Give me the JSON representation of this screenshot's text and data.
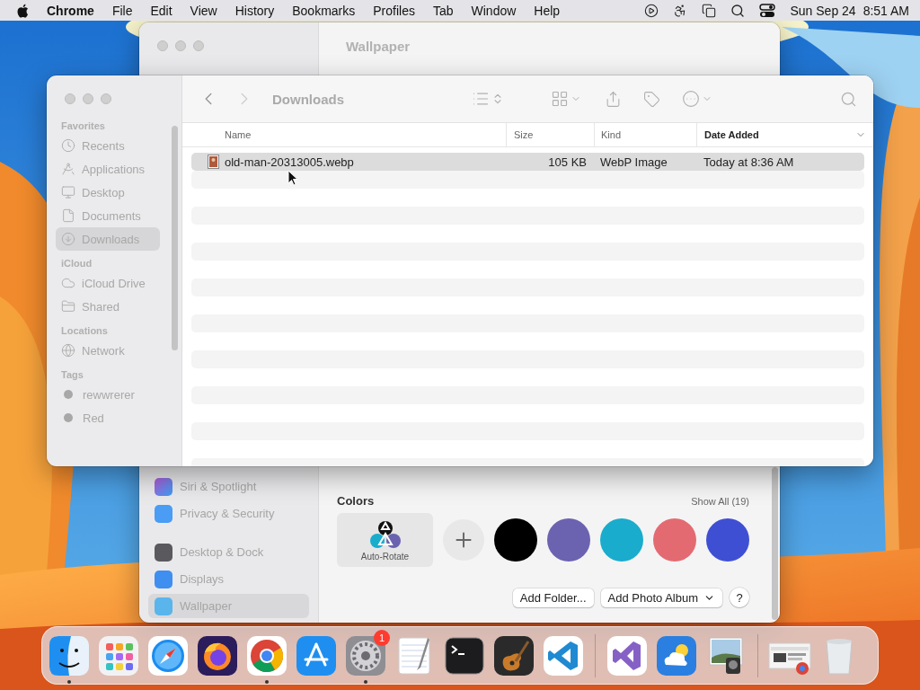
{
  "menu_bar": {
    "app_name": "Chrome",
    "menus": [
      "File",
      "Edit",
      "View",
      "History",
      "Bookmarks",
      "Profiles",
      "Tab",
      "Window",
      "Help"
    ],
    "date": "Sun Sep 24",
    "time": "8:51 AM"
  },
  "settings": {
    "title": "Wallpaper",
    "sidebar": {
      "groups": [
        [
          {
            "label": "Siri & Spotlight",
            "selected": false
          },
          {
            "label": "Privacy & Security",
            "selected": false
          }
        ],
        [
          {
            "label": "Desktop & Dock",
            "selected": false
          },
          {
            "label": "Displays",
            "selected": false
          },
          {
            "label": "Wallpaper",
            "selected": true
          }
        ]
      ]
    },
    "colors": {
      "heading": "Colors",
      "show_all": "Show All (19)",
      "swatches": [
        {
          "kind": "auto-rotate",
          "label": "Auto-Rotate"
        },
        {
          "kind": "add"
        },
        {
          "kind": "color",
          "color": "#000000"
        },
        {
          "kind": "color",
          "color": "#6b63b0"
        },
        {
          "kind": "color",
          "color": "#1aaccc"
        },
        {
          "kind": "color",
          "color": "#e46a72"
        },
        {
          "kind": "color",
          "color": "#3f4fd4"
        }
      ]
    },
    "buttons": [
      {
        "kind": "plain",
        "label": "Add Folder..."
      },
      {
        "kind": "dropdown",
        "label": "Add Photo Album"
      },
      {
        "kind": "help",
        "label": "?"
      }
    ]
  },
  "finder": {
    "title": "Downloads",
    "sidebar": [
      {
        "heading": "Favorites",
        "items": [
          {
            "label": "Recents",
            "selected": false
          },
          {
            "label": "Applications",
            "selected": false
          },
          {
            "label": "Desktop",
            "selected": false
          },
          {
            "label": "Documents",
            "selected": false
          },
          {
            "label": "Downloads",
            "selected": true
          }
        ]
      },
      {
        "heading": "iCloud",
        "items": [
          {
            "label": "iCloud Drive",
            "selected": false
          },
          {
            "label": "Shared",
            "selected": false
          }
        ]
      },
      {
        "heading": "Locations",
        "items": [
          {
            "label": "Network",
            "selected": false
          }
        ]
      },
      {
        "heading": "Tags",
        "items": [
          {
            "label": "rewwrerer",
            "selected": false,
            "color": "#a8a8a8"
          },
          {
            "label": "Red",
            "selected": false,
            "color": "#a8a8a8"
          }
        ]
      }
    ],
    "columns": [
      {
        "label": "Name",
        "sorted": false
      },
      {
        "label": "Size",
        "sorted": false
      },
      {
        "label": "Kind",
        "sorted": false
      },
      {
        "label": "Date Added",
        "sorted": true
      }
    ],
    "files": [
      {
        "name": "old-man-20313005.webp",
        "size": "105 KB",
        "kind": "WebP Image",
        "date_added": "Today at 8:36 AM",
        "selected": true
      }
    ]
  },
  "dock": {
    "groups": [
      [
        {
          "kind": "finder",
          "running": true
        },
        {
          "kind": "launchpad",
          "running": false
        },
        {
          "kind": "safari",
          "running": false
        },
        {
          "kind": "firefox",
          "running": false
        },
        {
          "kind": "chrome",
          "running": true
        },
        {
          "kind": "app-store",
          "running": false
        },
        {
          "kind": "settings",
          "running": true,
          "badge": "1"
        },
        {
          "kind": "textedit",
          "running": false
        },
        {
          "kind": "terminal",
          "running": false
        },
        {
          "kind": "guitar",
          "running": false
        },
        {
          "kind": "vscode",
          "running": false
        }
      ],
      [
        {
          "kind": "visual-studio",
          "running": false
        },
        {
          "kind": "weather",
          "running": false
        },
        {
          "kind": "preview",
          "running": false
        }
      ],
      [
        {
          "kind": "window-thumbnail",
          "running": false
        },
        {
          "kind": "trash",
          "running": false
        }
      ]
    ]
  }
}
